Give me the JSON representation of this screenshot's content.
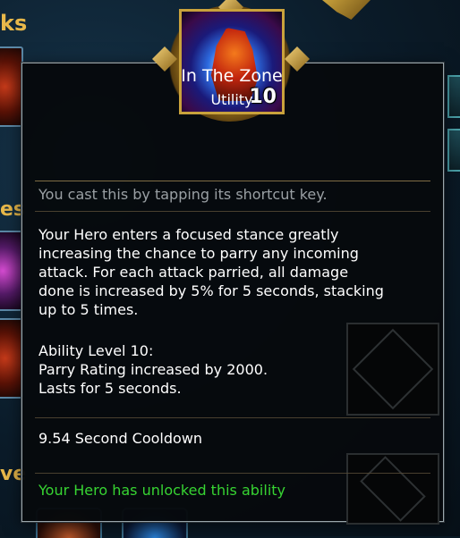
{
  "background": {
    "section_1_tail": "ks",
    "section_2_tail": "es",
    "section_3_tail": "ve"
  },
  "tooltip": {
    "icon": "in-the-zone-ability-icon",
    "ability_level_badge": "10",
    "title": "In The Zone",
    "category": "Utility",
    "cast_hint": "You cast this by tapping its shortcut key.",
    "description": [
      "Your Hero enters a focused stance greatly",
      "increasing the chance to parry any incoming",
      "attack. For each attack parried, all damage",
      "done is increased by 5% for 5 seconds, stacking",
      "up to 5 times."
    ],
    "level_details": [
      "Ability Level 10:",
      "Parry Rating increased by 2000.",
      "Lasts for 5 seconds."
    ],
    "cooldown": "9.54 Second Cooldown",
    "unlock_status": "Your Hero has unlocked this ability"
  },
  "colors": {
    "accent_gold": "#c9a23c",
    "unlocked_green": "#37d432",
    "hint_gray": "#9aa0a4",
    "header_gold": "#e8b84a"
  }
}
